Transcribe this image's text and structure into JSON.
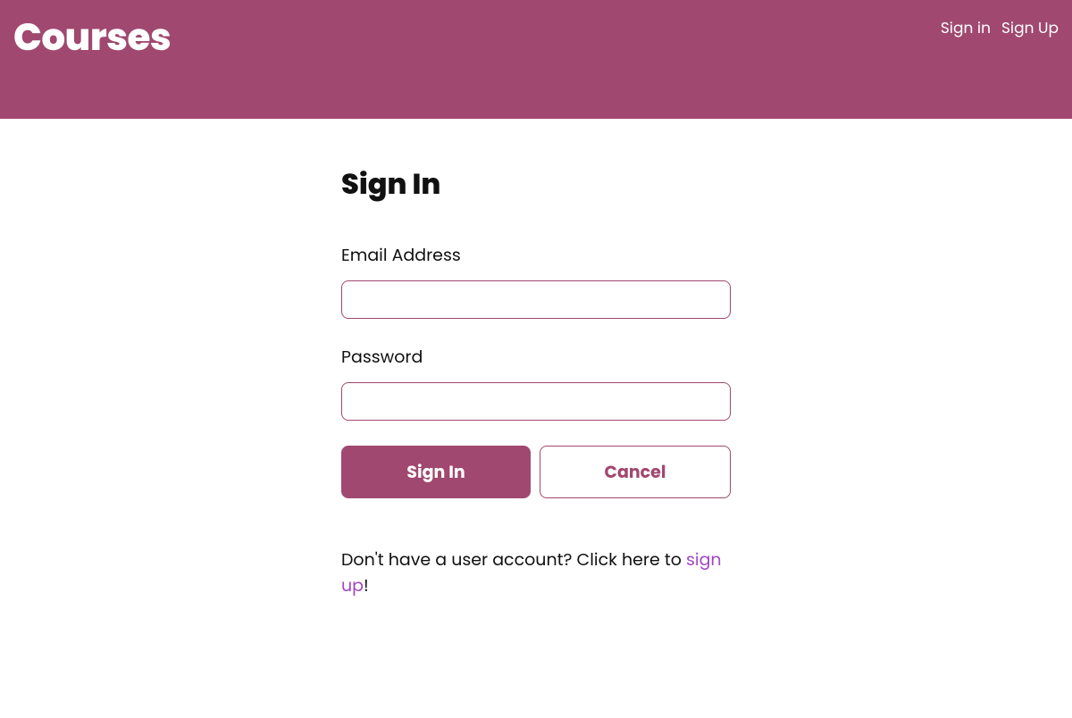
{
  "header": {
    "logo": "Courses",
    "nav": {
      "signin": "Sign in",
      "signup": "Sign Up"
    }
  },
  "main": {
    "title": "Sign In",
    "form": {
      "email_label": "Email Address",
      "password_label": "Password",
      "submit_label": "Sign In",
      "cancel_label": "Cancel"
    },
    "prompt": {
      "text_before": "Don't have a user account? Click here to ",
      "link_text": "sign up",
      "text_after": "!"
    }
  }
}
